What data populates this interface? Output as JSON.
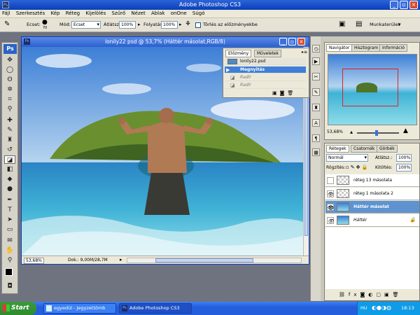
{
  "app": {
    "title": "Adobe Photoshop CS3",
    "icon": "ps-app-icon"
  },
  "menu": [
    "Fájl",
    "Szerkesztés",
    "Kép",
    "Réteg",
    "Kijelölés",
    "Szűrő",
    "Nézet",
    "Ablak",
    "onOne",
    "Súgó"
  ],
  "options": {
    "brush_label": "Ecset:",
    "brush_size": "70",
    "mode_label": "Mód:",
    "mode_value": "Ecset",
    "opacity_label": "Átlátsz.:",
    "opacity_value": "100%",
    "flow_label": "Folyatás:",
    "flow_value": "100%",
    "erase_history_label": "Törlés az előzményekbe",
    "workspace_label": "Munkaterület"
  },
  "document": {
    "title": "lonily22 psd @ 53,7% (Háttér másolat,RGB/8)",
    "zoom": "53,68%",
    "doc_size": "Dok.: 9,00M/28,7M"
  },
  "history": {
    "tabs": [
      "Előzmény",
      "Műveletek"
    ],
    "snapshot": "lonily22.psd",
    "items": [
      {
        "label": "Megnyitás",
        "selected": true
      },
      {
        "label": "Radír",
        "selected": false
      },
      {
        "label": "Radír",
        "selected": false
      }
    ]
  },
  "navigator": {
    "tabs": [
      "Navigátor",
      "Hisztogram",
      "Információ"
    ],
    "zoom": "53,68%"
  },
  "layers": {
    "tabs": [
      "Rétegek",
      "Csatornák",
      "Görbék"
    ],
    "blend_mode": "Normál",
    "opacity_label": "Átlátsz.:",
    "opacity_value": "100%",
    "lock_label": "Rögzítés:",
    "fill_label": "Kitöltés:",
    "fill_value": "100%",
    "items": [
      {
        "name": "réteg 13 másolata",
        "visible": false,
        "selected": false
      },
      {
        "name": "réteg 1 másolata 2",
        "visible": true,
        "selected": false
      },
      {
        "name": "Háttér másolat",
        "visible": true,
        "selected": true
      },
      {
        "name": "Háttér",
        "visible": true,
        "selected": false
      }
    ]
  },
  "taskbar": {
    "start": "Start",
    "tasks": [
      "egyedül - Jegyzettömb",
      "Adobe Photoshop CS3"
    ],
    "lang": "HU",
    "clock": "18:13"
  }
}
